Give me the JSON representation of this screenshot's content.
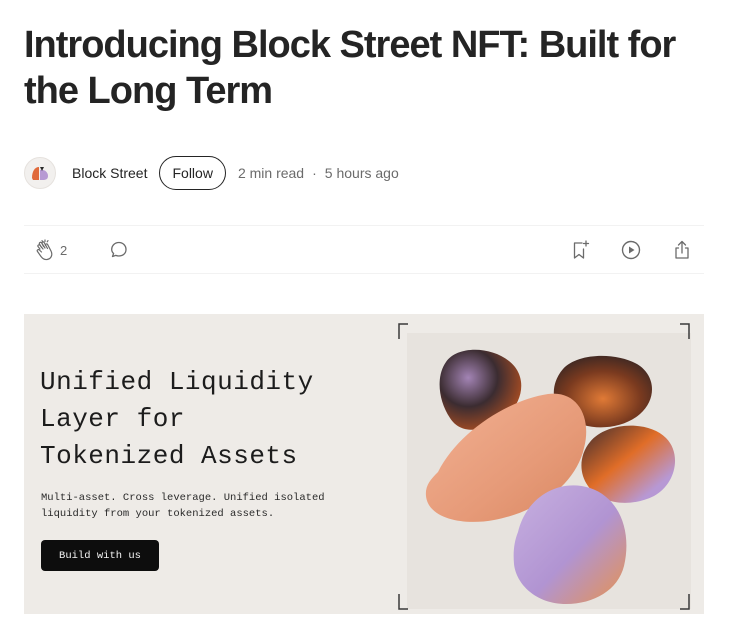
{
  "article": {
    "title": "Introducing Block Street NFT: Built for the Long Term",
    "author": "Block Street",
    "follow_label": "Follow",
    "read_time": "2 min read",
    "separator": "·",
    "published": "5 hours ago"
  },
  "actions": {
    "clap_count": "2",
    "icons": [
      "clap-icon",
      "comment-icon",
      "bookmark-add-icon",
      "play-circle-icon",
      "share-icon"
    ]
  },
  "hero": {
    "headline_lines": [
      "Unified Liquidity",
      "Layer for",
      "Tokenized Assets"
    ],
    "subtext_lines": [
      "Multi-asset. Cross leverage. Unified isolated",
      "liquidity from your tokenized assets."
    ],
    "cta_label": "Build with us",
    "colors": {
      "background": "#eeebe7",
      "peach": "#e9a07f",
      "lavender": "#b79ad3",
      "orange": "#d9652a",
      "dark": "#3a2a2e"
    }
  }
}
